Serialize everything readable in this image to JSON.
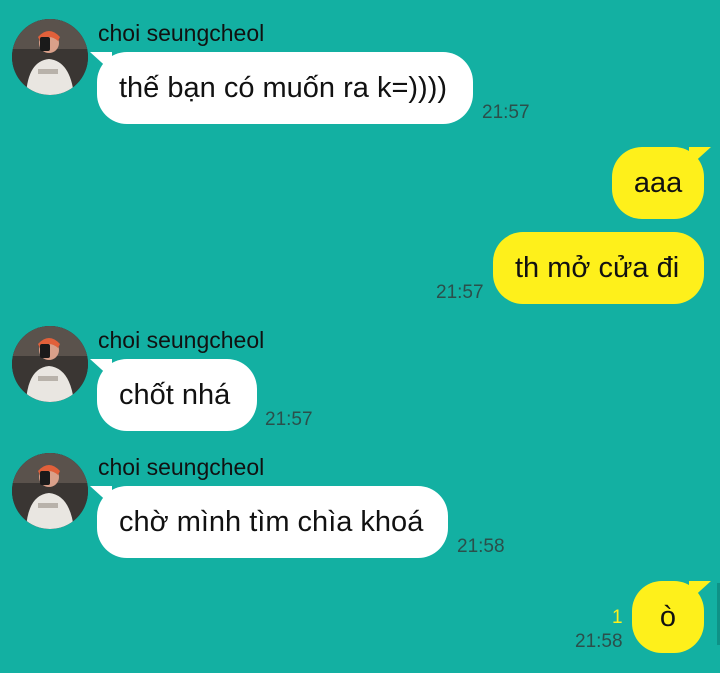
{
  "colors": {
    "background": "#13b0a2",
    "incoming_bubble": "#ffffff",
    "outgoing_bubble": "#fef01b",
    "timestamp": "#2b4f4b"
  },
  "messages": [
    {
      "direction": "incoming",
      "sender": "choi seungcheol",
      "text": "thế bạn có muốn ra k=))))",
      "time": "21:57"
    },
    {
      "direction": "outgoing",
      "text": "aaa"
    },
    {
      "direction": "outgoing",
      "text": "th mở cửa đi",
      "time": "21:57"
    },
    {
      "direction": "incoming",
      "sender": "choi seungcheol",
      "text": "chốt nhá",
      "time": "21:57"
    },
    {
      "direction": "incoming",
      "sender": "choi seungcheol",
      "text": "chờ mình tìm chìa khoá",
      "time": "21:58"
    },
    {
      "direction": "outgoing",
      "text": "ò",
      "time": "21:58",
      "unread_count": "1"
    }
  ],
  "icons": {
    "avatar": "profile-photo-icon"
  }
}
